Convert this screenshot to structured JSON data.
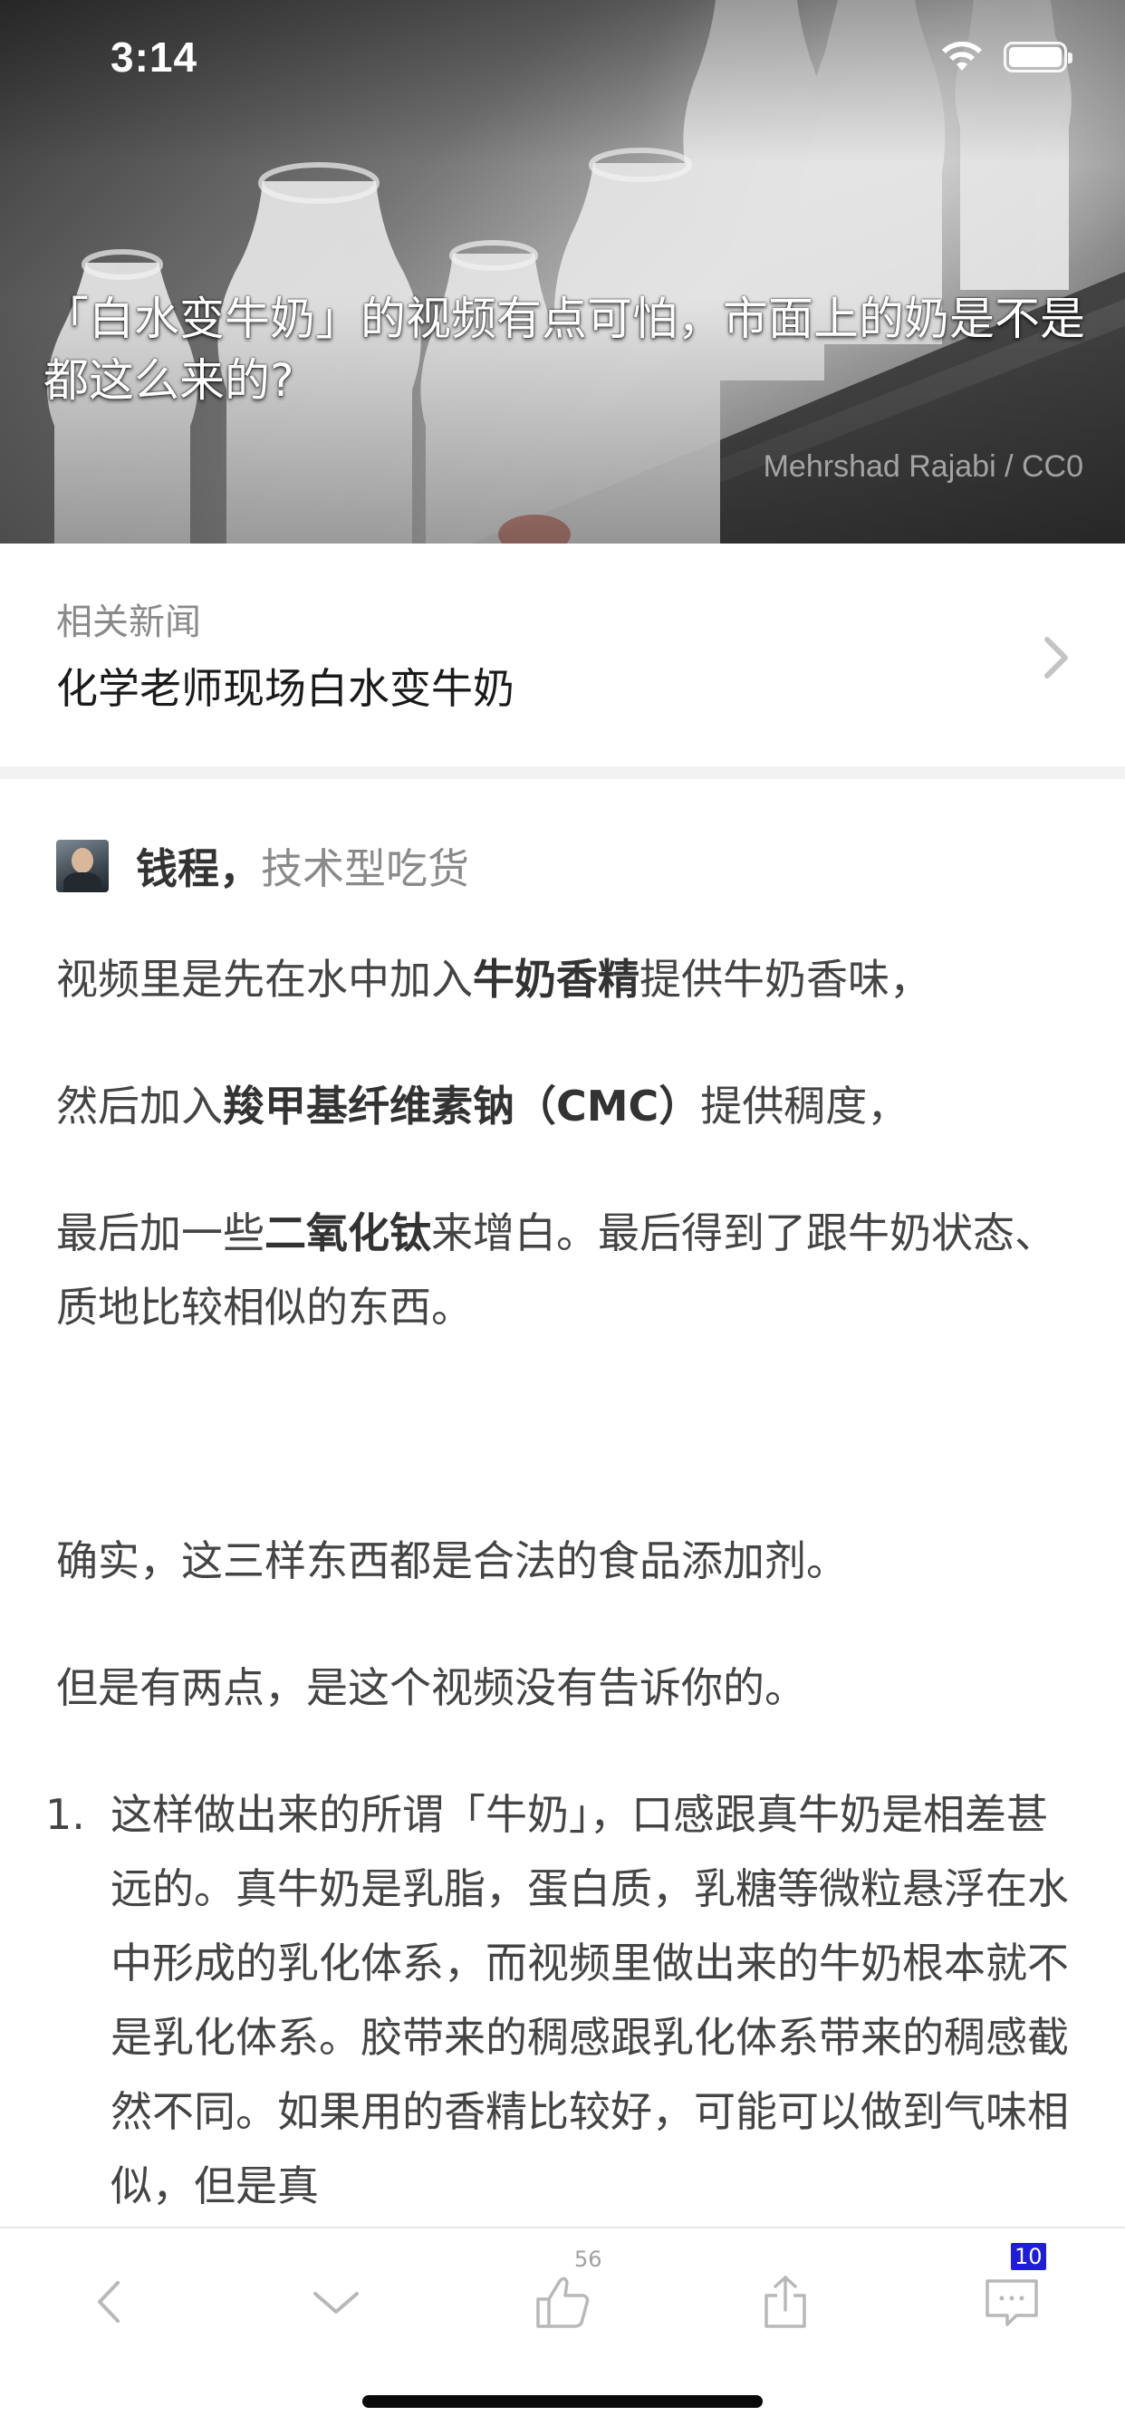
{
  "status_bar": {
    "time": "3:14"
  },
  "hero": {
    "title": "「白水变牛奶」的视频有点可怕，市面上的奶是不是都这么来的?",
    "photo_credit": "Mehrshad Rajabi / CC0"
  },
  "related": {
    "label": "相关新闻",
    "title": "化学老师现场白水变牛奶"
  },
  "answer": {
    "author_name": "钱程，",
    "author_bio": "技术型吃货",
    "p1": {
      "a": "视频里是先在水中加入",
      "b": "牛奶香精",
      "c": "提供牛奶香味，"
    },
    "p2": {
      "a": "然后加入",
      "b": "羧甲基纤维素钠（CMC）",
      "c": "提供稠度，"
    },
    "p3": {
      "a": "最后加一些",
      "b": "二氧化钛",
      "c": "来增白。最后得到了跟牛奶状态、质地比较相似的东西。"
    },
    "p4": "确实，这三样东西都是合法的食品添加剂。",
    "p5": "但是有两点，是这个视频没有告诉你的。",
    "list": [
      {
        "num": "1.",
        "text": "这样做出来的所谓「牛奶」，口感跟真牛奶是相差甚远的。真牛奶是乳脂，蛋白质，乳糖等微粒悬浮在水中形成的乳化体系，而视频里做出来的牛奶根本就不是乳化体系。胶带来的稠感跟乳化体系带来的稠感截然不同。如果用的香精比较好，可能可以做到气味相似，但是真"
      }
    ]
  },
  "toolbar": {
    "like_count": "56",
    "comment_count": "10"
  },
  "icons": {
    "back": "chevron-left-icon",
    "next": "chevron-down-icon",
    "like": "thumbs-up-icon",
    "share": "share-icon",
    "comment": "comment-icon"
  },
  "colors": {
    "badge": "#1d1ddb",
    "text": "#444444",
    "muted": "#8a8a8a"
  }
}
